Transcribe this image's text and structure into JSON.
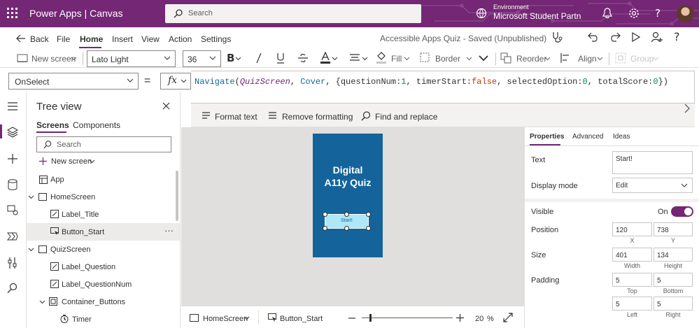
{
  "titlebar": {
    "app_title": "Power Apps  |  Canvas",
    "search_placeholder": "Search",
    "environment_label": "Environment",
    "environment_name": "Microsoft Student Partn"
  },
  "menubar": {
    "back": "Back",
    "items": [
      "File",
      "Home",
      "Insert",
      "View",
      "Action",
      "Settings"
    ],
    "active": "Home",
    "doc_title": "Accessible Apps Quiz - Saved (Unpublished)"
  },
  "ribbon": {
    "new_screen": "New screen",
    "font_family": "Lato Light",
    "font_size": "36",
    "fill": "Fill",
    "border": "Border",
    "reorder": "Reorder",
    "align": "Align",
    "group": "Group"
  },
  "formula_bar": {
    "property": "OnSelect",
    "equals": "=",
    "fx": "fx",
    "formula": "Navigate(QuizScreen, Cover, {questionNum:1, timerStart:false, selectedOption:0, totalScore:0})"
  },
  "format_bar": {
    "format_text": "Format text",
    "remove_formatting": "Remove formatting",
    "find_replace": "Find and replace"
  },
  "tree_view": {
    "title": "Tree view",
    "tabs": [
      "Screens",
      "Components"
    ],
    "search_placeholder": "Search",
    "new_screen": "New screen",
    "nodes": [
      {
        "label": "App",
        "level": 0,
        "icon": "app"
      },
      {
        "label": "HomeScreen",
        "level": 0,
        "icon": "screen",
        "expanded": true
      },
      {
        "label": "Label_Title",
        "level": 1,
        "icon": "label"
      },
      {
        "label": "Button_Start",
        "level": 1,
        "icon": "button",
        "selected": true
      },
      {
        "label": "QuizScreen",
        "level": 0,
        "icon": "screen",
        "expanded": true
      },
      {
        "label": "Label_Question",
        "level": 1,
        "icon": "label"
      },
      {
        "label": "Label_QuestionNum",
        "level": 1,
        "icon": "label"
      },
      {
        "label": "Container_Buttons",
        "level": 1,
        "icon": "container",
        "expanded": true
      },
      {
        "label": "Timer",
        "level": 2,
        "icon": "timer"
      }
    ],
    "more": "···"
  },
  "canvas": {
    "phone_title": "Digital\nA11y Quiz",
    "button_text": "Start!"
  },
  "bottombar": {
    "screen": "HomeScreen",
    "control": "Button_Start",
    "zoom": "20",
    "zoom_unit": "%"
  },
  "properties": {
    "tabs": [
      "Properties",
      "Advanced",
      "Ideas"
    ],
    "active_tab": "Properties",
    "text_label": "Text",
    "text_value": "Start!",
    "display_mode_label": "Display mode",
    "display_mode_value": "Edit",
    "visible_label": "Visible",
    "visible_state": "On",
    "position_label": "Position",
    "position_x": "120",
    "position_y": "738",
    "x_label": "X",
    "y_label": "Y",
    "size_label": "Size",
    "width": "401",
    "height": "134",
    "width_label": "Width",
    "height_label": "Height",
    "padding_label": "Padding",
    "padding_top": "5",
    "padding_bottom": "5",
    "padding_left": "5",
    "padding_right": "5",
    "top_label": "Top",
    "bottom_label": "Bottom",
    "left_label": "Left",
    "right_label": "Right"
  },
  "colors": {
    "brand": "#742774",
    "phone_bg": "#14649b",
    "button_bg": "#aee7f5"
  }
}
